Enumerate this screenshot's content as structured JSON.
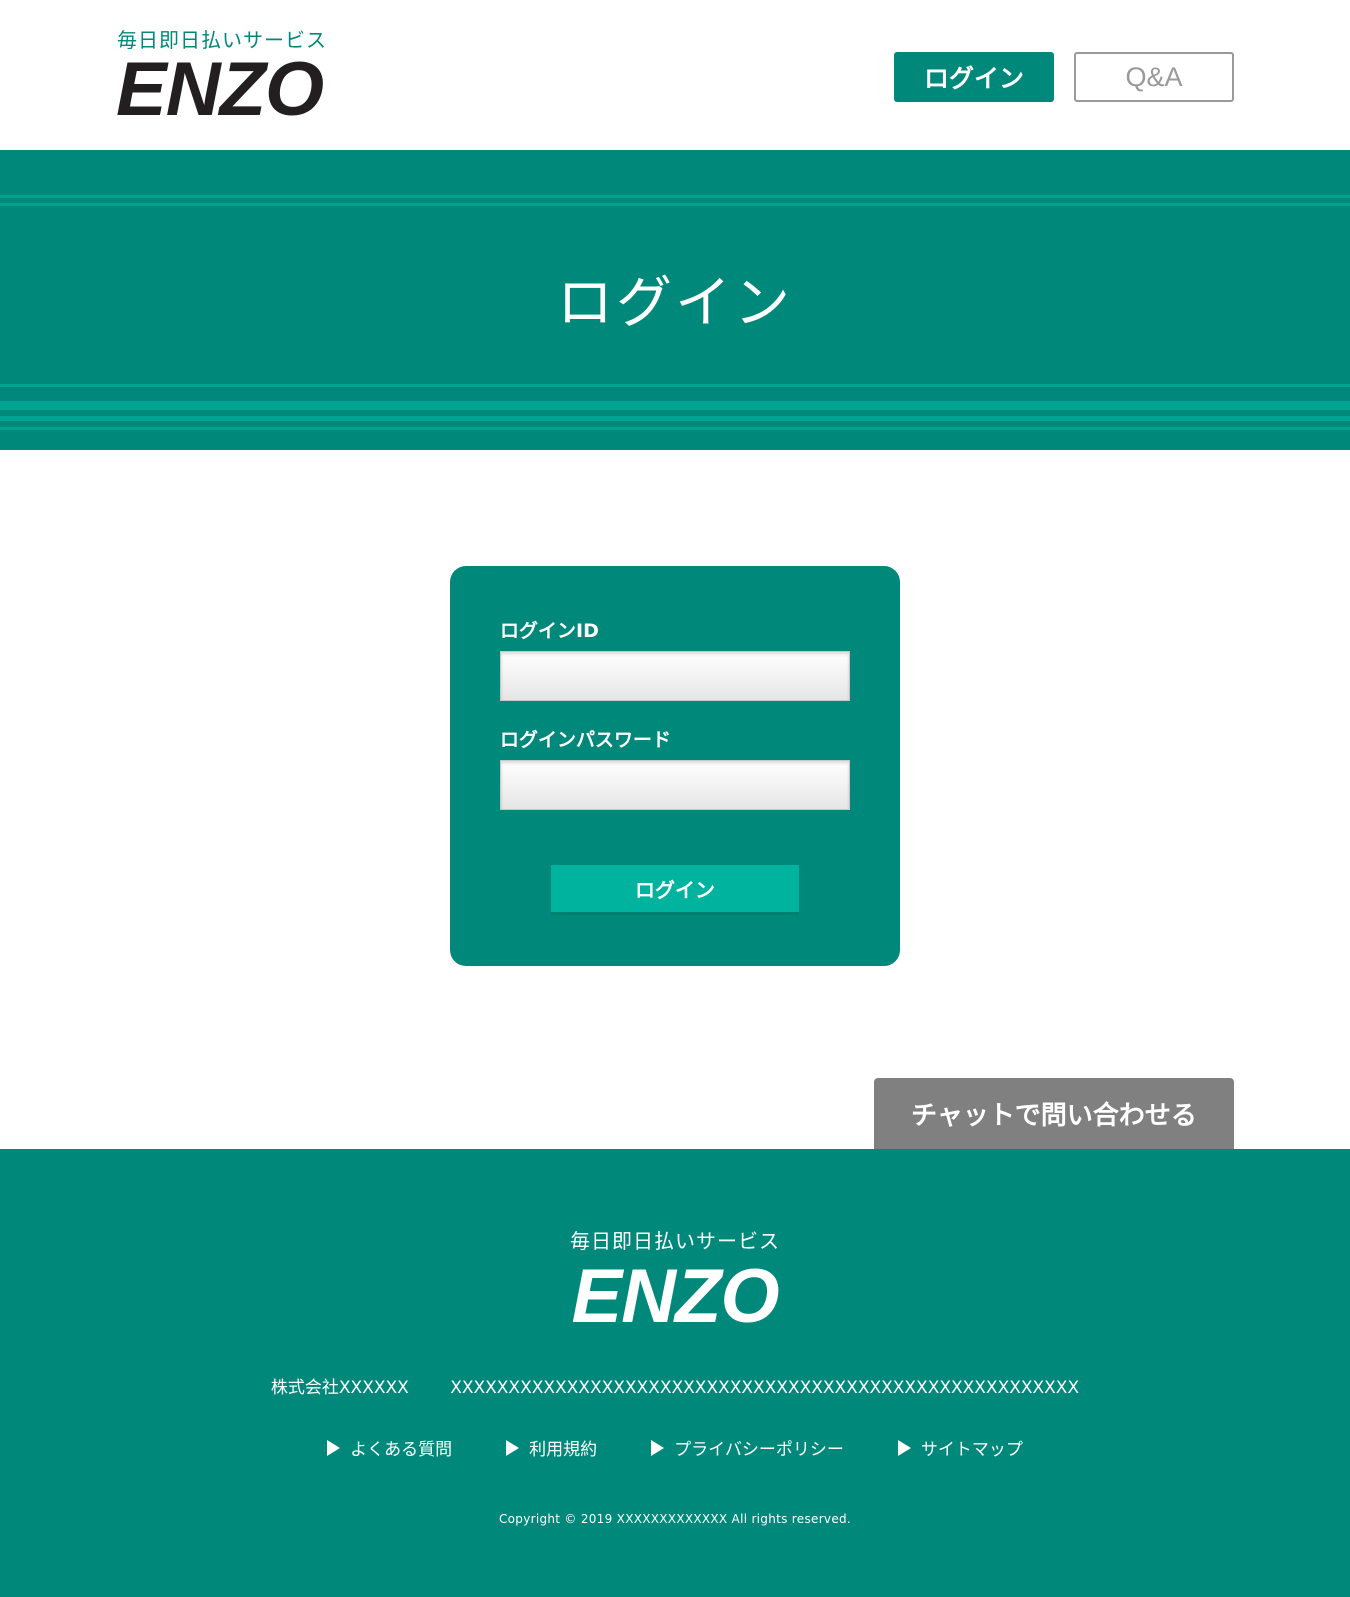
{
  "header": {
    "tagline": "毎日即日払いサービス",
    "logo": "ENZO",
    "login_button": "ログイン",
    "qa_button": "Q&A"
  },
  "hero": {
    "title": "ログイン"
  },
  "login_form": {
    "id_label": "ログインID",
    "id_value": "",
    "password_label": "ログインパスワード",
    "password_value": "",
    "submit_label": "ログイン"
  },
  "chat": {
    "label": "チャットで問い合わせる"
  },
  "footer": {
    "tagline": "毎日即日払いサービス",
    "logo": "ENZO",
    "company_name": "株式会社XXXXXX",
    "company_address": "XXXXXXXXXXXXXXXXXXXXXXXXXXXXXXXXXXXXXXXXXXXXXXXXXXXXXX",
    "links": [
      {
        "label": "よくある質問"
      },
      {
        "label": "利用規約"
      },
      {
        "label": "プライバシーポリシー"
      },
      {
        "label": "サイトマップ"
      }
    ],
    "copyright": "Copyright © 2019 XXXXXXXXXXXXX All rights reserved."
  },
  "colors": {
    "primary": "#00897b",
    "stripe": "#00a38f",
    "button_accent": "#00b39f",
    "chat_button": "#808080",
    "logo_dark": "#231f20"
  },
  "icons": {
    "footer_link_bullet": "triangle-right-icon"
  }
}
